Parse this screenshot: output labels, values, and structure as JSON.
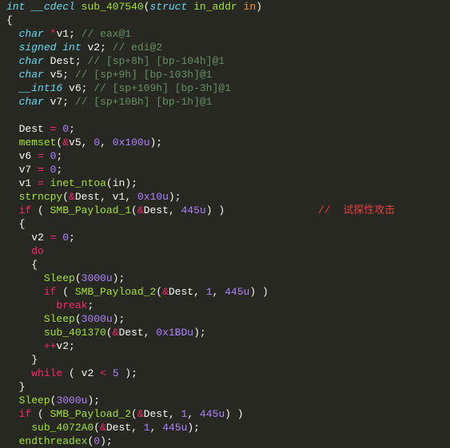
{
  "code": {
    "sig": {
      "ret": "int",
      "cc": "__cdecl",
      "name": "sub_407540",
      "struct_kw": "struct",
      "ptype": "in_addr",
      "pname": "in"
    },
    "decl": {
      "l1_type": "char",
      "l1_ptr": "*",
      "l1_name": "v1",
      "l1_c": "// eax@1",
      "l2_type": "signed int",
      "l2_name": "v2",
      "l2_c": "// edi@2",
      "l3_type": "char",
      "l3_name": "Dest",
      "l3_c": "// [sp+8h] [bp-104h]@1",
      "l4_type": "char",
      "l4_name": "v5",
      "l4_c": "// [sp+9h] [bp-103h]@1",
      "l5_type": "__int16",
      "l5_name": "v6",
      "l5_c": "// [sp+109h] [bp-3h]@1",
      "l6_type": "char",
      "l6_name": "v7",
      "l6_c": "// [sp+10Bh] [bp-1h]@1"
    },
    "b": {
      "dest_assign": "Dest",
      "zero1": "0",
      "memset": "memset",
      "amp": "&",
      "v5": "v5",
      "memset_a2": "0",
      "memset_a3": "0x100u",
      "v6": "v6",
      "v6_v": "0",
      "v7": "v7",
      "v7_v": "0",
      "v1": "v1",
      "inet_ntoa": "inet_ntoa",
      "in": "in",
      "strncpy": "strncpy",
      "dest_ref": "Dest",
      "strncpy_a3": "0x10u",
      "if_kw": "if",
      "smb1": "SMB_Payload_1",
      "port": "445u",
      "cn_comment": "//  试探性攻击",
      "v2": "v2",
      "v2_v": "0",
      "do_kw": "do",
      "sleep": "Sleep",
      "sleep_a": "3000u",
      "smb2": "SMB_Payload_2",
      "one": "1",
      "break_kw": "break",
      "sub401370": "sub_401370",
      "sub401370_a2": "0x1BDu",
      "ppv2": "v2",
      "while_kw": "while",
      "five": "5",
      "sub4072A0": "sub_4072A0",
      "endthreadex": "endthreadex"
    }
  }
}
